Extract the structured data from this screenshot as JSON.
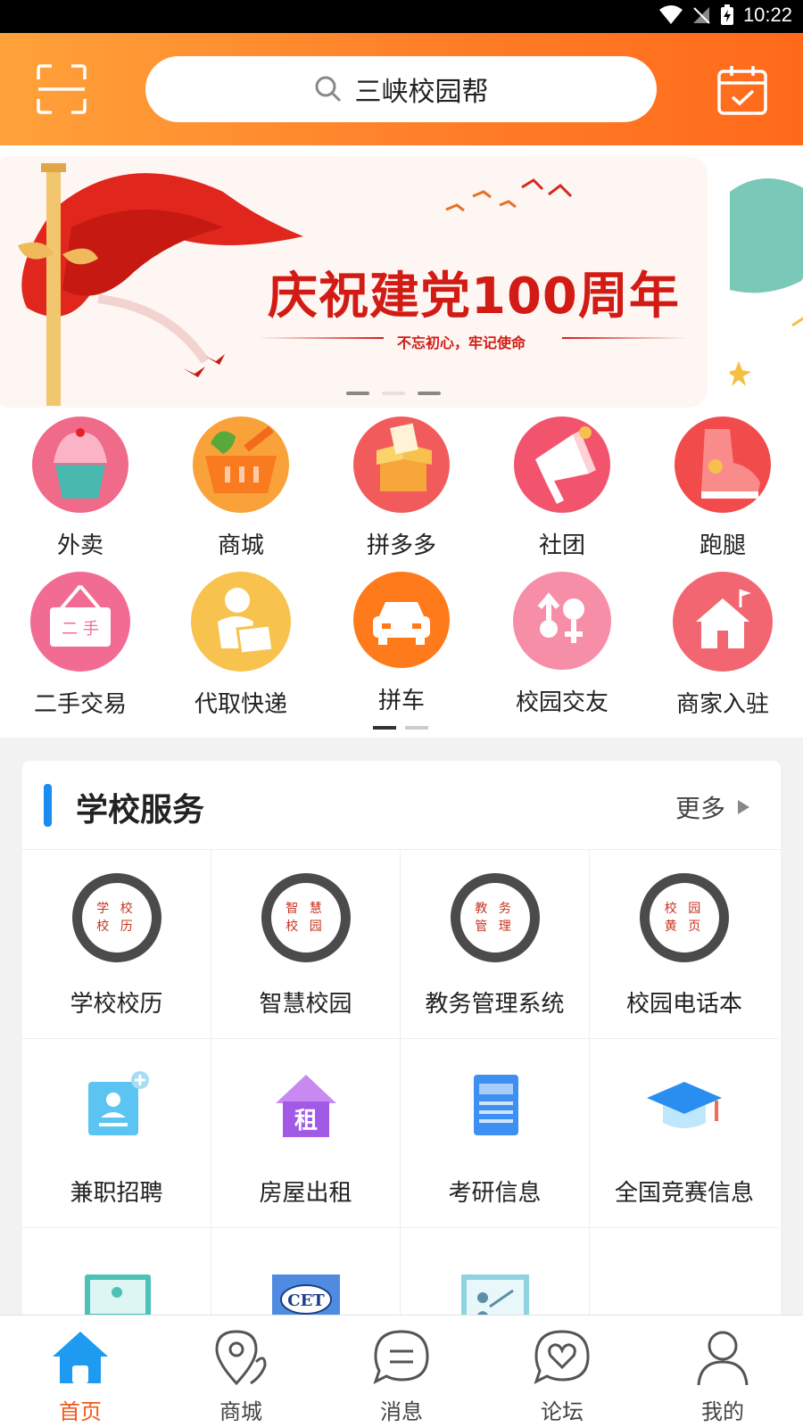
{
  "status_bar": {
    "time": "10:22"
  },
  "header": {
    "search_placeholder": "三峡校园帮",
    "scan_icon": "scan-icon",
    "calendar_icon": "calendar-check-icon"
  },
  "banner": {
    "title": "庆祝建党100周年",
    "subtitle": "不忘初心，牢记使命",
    "page_count": 3,
    "active_index": 1
  },
  "quick_items": [
    {
      "label": "外卖",
      "icon": "cupcake-icon",
      "color": "#f06a8a"
    },
    {
      "label": "商城",
      "icon": "basket-icon",
      "color": "#f9a23a"
    },
    {
      "label": "拼多多",
      "icon": "gift-box-icon",
      "color": "#f25b5b"
    },
    {
      "label": "社团",
      "icon": "megaphone-icon",
      "color": "#f2546e"
    },
    {
      "label": "跑腿",
      "icon": "shoe-icon",
      "color": "#f24b4b"
    },
    {
      "label": "二手交易",
      "icon": "secondhand-sign-icon",
      "color": "#f26b93"
    },
    {
      "label": "代取快递",
      "icon": "courier-icon",
      "color": "#f8c24f"
    },
    {
      "label": "拼车",
      "icon": "car-icon",
      "color": "#ff7a1a"
    },
    {
      "label": "校园交友",
      "icon": "gender-icon",
      "color": "#f78ea8"
    },
    {
      "label": "商家入驻",
      "icon": "store-house-icon",
      "color": "#f26672"
    }
  ],
  "school_services": {
    "title": "学校服务",
    "more_label": "更多",
    "items": [
      {
        "label": "学校校历",
        "seal": [
          "学 校",
          "校 历"
        ]
      },
      {
        "label": "智慧校园",
        "seal": [
          "智 慧",
          "校 园"
        ]
      },
      {
        "label": "教务管理系统",
        "seal": [
          "教 务",
          "管 理"
        ]
      },
      {
        "label": "校园电话本",
        "seal": [
          "校 园",
          "黄 页"
        ]
      },
      {
        "label": "兼职招聘",
        "icon": "job-card-icon"
      },
      {
        "label": "房屋出租",
        "icon": "rent-house-icon",
        "badge": "租"
      },
      {
        "label": "考研信息",
        "icon": "notebook-icon"
      },
      {
        "label": "全国竞赛信息",
        "icon": "graduation-cap-icon"
      },
      {
        "label": "",
        "icon": "laptop-icon"
      },
      {
        "label": "",
        "icon": "cet-icon",
        "badge": "CET"
      },
      {
        "label": "",
        "icon": "teacher-board-icon"
      },
      {
        "label": ""
      }
    ]
  },
  "tab_bar": [
    {
      "label": "首页",
      "icon": "home-icon",
      "active": true
    },
    {
      "label": "商城",
      "icon": "map-pin-icon",
      "active": false
    },
    {
      "label": "消息",
      "icon": "chat-bubble-icon",
      "active": false
    },
    {
      "label": "论坛",
      "icon": "heart-bubble-icon",
      "active": false
    },
    {
      "label": "我的",
      "icon": "user-icon",
      "active": false
    }
  ]
}
